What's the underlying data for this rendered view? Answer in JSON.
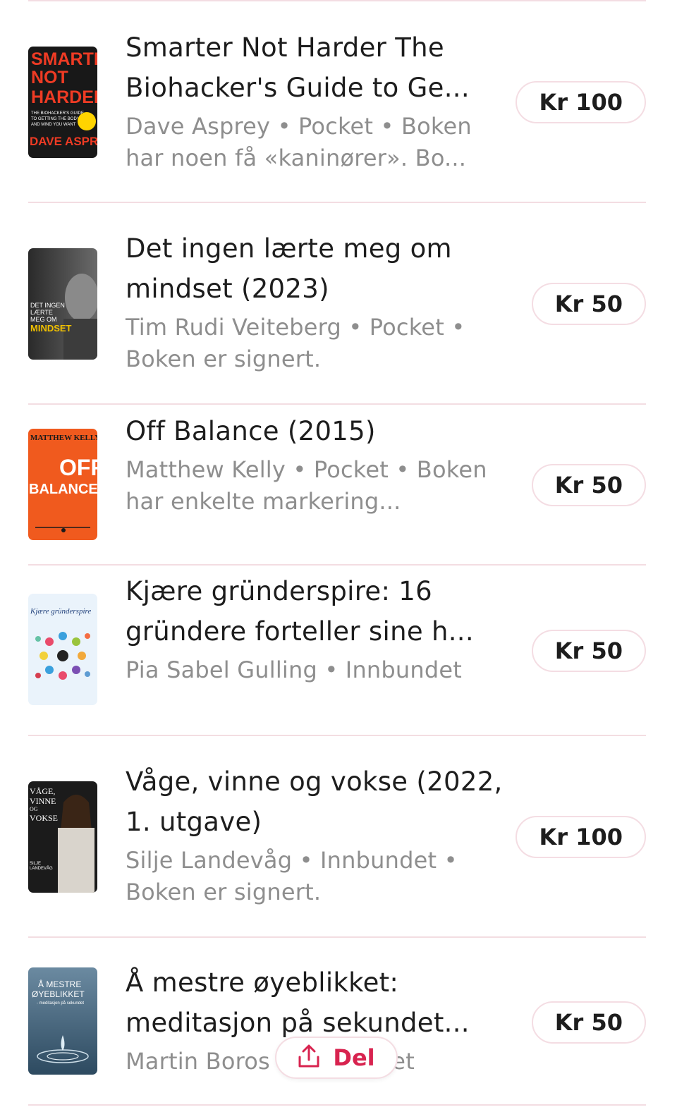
{
  "books": [
    {
      "title": "Smarter Not Harder The Biohacker's Guide to Ge...",
      "meta": "Dave Asprey • Pocket • Boken har noen få «kaninører». Bo...",
      "price": "Kr 100",
      "cover": {
        "lines": [
          "SMARTER",
          "NOT",
          "HARDER",
          "DAVE ASPREY"
        ],
        "small": [
          "THE BIOHACKER'S GUIDE",
          "TO GETTING THE BODY",
          "AND MIND YOU WANT"
        ],
        "colors": [
          "#1a1a1a",
          "#ef3b24",
          "#ffd400"
        ]
      }
    },
    {
      "title": "Det ingen lærte meg om mindset (2023)",
      "meta": "Tim Rudi Veiteberg • Pocket • Boken er signert.",
      "price": "Kr 50",
      "cover": {
        "lines": [
          "DET INGEN",
          "LÆRTE",
          "MEG OM",
          "MINDSET"
        ],
        "colors": [
          "#3a3a3a",
          "#f0c000"
        ]
      }
    },
    {
      "title": "Off Balance (2015)",
      "meta": "Matthew Kelly • Pocket • Boken har enkelte markering...",
      "price": "Kr 50",
      "cover": {
        "lines": [
          "MATTHEW KELLY",
          "OFF",
          "BALANCE"
        ],
        "colors": [
          "#f05a1e",
          "#ffffff"
        ]
      }
    },
    {
      "title": "Kjære gründerspire: 16 gründere forteller sine h...",
      "meta": "Pia Sabel Gulling • Innbundet",
      "price": "Kr 50",
      "cover": {
        "lines": [
          "Kjære gründerspire"
        ],
        "colors": [
          "#eaf3fb",
          "#1f3f7a"
        ]
      }
    },
    {
      "title": "Våge, vinne og vokse (2022, 1. utgave)",
      "meta": "Silje Landevåg • Innbundet • Boken er signert.",
      "price": "Kr 100",
      "cover": {
        "lines": [
          "VÅGE,",
          "VINNE",
          "OG",
          "VOKSE",
          "SILJE",
          "LANDEVÅG"
        ],
        "colors": [
          "#1b1b1b",
          "#ffffff"
        ]
      }
    },
    {
      "title": "Å mestre øyeblikket: meditasjon på sekundet...",
      "meta": "Martin Boros • Innbundet",
      "price": "Kr 50",
      "cover": {
        "lines": [
          "Å MESTRE",
          "ØYEBLIKKET",
          "- meditasjon på sekundet"
        ],
        "colors": [
          "#4f6f86",
          "#ffffff"
        ]
      }
    }
  ],
  "share": {
    "label": "Del",
    "icon": "share-upload-icon",
    "accent": "#d8234f"
  }
}
